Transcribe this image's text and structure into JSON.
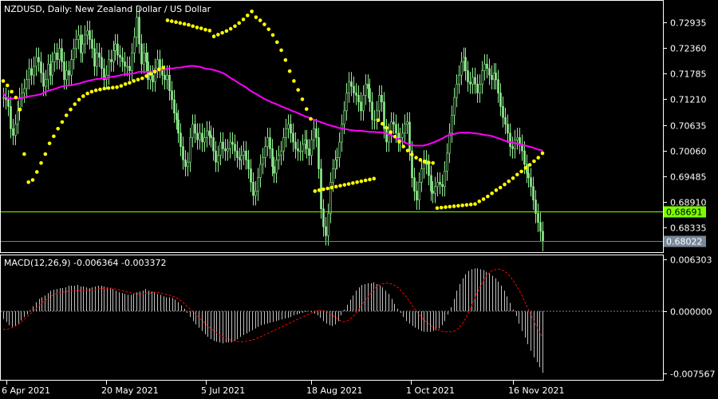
{
  "main_title": "NZDUSD, Daily:  New Zealand Dollar / US Dollar",
  "macd_title": "MACD(12,26,9) -0.006364 -0.003372",
  "colors": {
    "background": "#000000",
    "frame": "#ffffff",
    "candle": "#90ee90",
    "ma_line": "#ff00ff",
    "sar_dots": "#ffff00",
    "level_line": "#7cfc00",
    "level_label_bg": "#7cfc00",
    "bid_line": "#708090",
    "bid_label_bg": "#778899",
    "macd_hist": "#c0c0c0",
    "macd_signal": "#ff0000",
    "zero_line": "#808080"
  },
  "chart_data": [
    {
      "type": "candlestick",
      "title": "NZDUSD, Daily:  New Zealand Dollar / US Dollar",
      "ylim": [
        0.6775,
        0.7335
      ],
      "y_ticks": [
        "0.72935",
        "0.72360",
        "0.71785",
        "0.71210",
        "0.70635",
        "0.70060",
        "0.69485",
        "0.68910",
        "0.68335"
      ],
      "x_ticks": [
        "6 Apr 2021",
        "20 May 2021",
        "5 Jul 2021",
        "18 Aug 2021",
        "1 Oct 2021",
        "16 Nov 2021"
      ],
      "price_labels": {
        "horizontal_level": "0.68691",
        "last_price": "0.68022"
      },
      "close": [
        0.7125,
        0.712,
        0.7105,
        0.7055,
        0.704,
        0.7065,
        0.7095,
        0.7125,
        0.7135,
        0.7145,
        0.7165,
        0.719,
        0.7175,
        0.7195,
        0.7215,
        0.7205,
        0.718,
        0.715,
        0.7165,
        0.72,
        0.7175,
        0.7205,
        0.7225,
        0.721,
        0.7235,
        0.7205,
        0.7165,
        0.7185,
        0.7175,
        0.721,
        0.7235,
        0.7255,
        0.7265,
        0.7225,
        0.7245,
        0.7265,
        0.7275,
        0.7255,
        0.7235,
        0.7195,
        0.7225,
        0.7215,
        0.719,
        0.7165,
        0.7175,
        0.721,
        0.7205,
        0.723,
        0.7245,
        0.722,
        0.7215,
        0.7205,
        0.7195,
        0.7195,
        0.7185,
        0.7225,
        0.726,
        0.7305,
        0.7245,
        0.72,
        0.7225,
        0.7205,
        0.7165,
        0.7175,
        0.716,
        0.719,
        0.721,
        0.719,
        0.7175,
        0.7165,
        0.7175,
        0.714,
        0.712,
        0.709,
        0.7075,
        0.7045,
        0.7015,
        0.6985,
        0.697,
        0.698,
        0.7035,
        0.7065,
        0.7045,
        0.703,
        0.7045,
        0.7025,
        0.7035,
        0.705,
        0.704,
        0.7035,
        0.7005,
        0.698,
        0.6995,
        0.7025,
        0.701,
        0.7005,
        0.701,
        0.7025,
        0.702,
        0.7005,
        0.699,
        0.6985,
        0.6995,
        0.7005,
        0.6985,
        0.6965,
        0.6935,
        0.6905,
        0.6915,
        0.6945,
        0.6975,
        0.699,
        0.7015,
        0.7035,
        0.701,
        0.697,
        0.6955,
        0.6985,
        0.6995,
        0.7005,
        0.7035,
        0.7055,
        0.7065,
        0.7045,
        0.7025,
        0.701,
        0.7005,
        0.7005,
        0.702,
        0.703,
        0.701,
        0.6995,
        0.703,
        0.7055,
        0.7035,
        0.6965,
        0.6875,
        0.6835,
        0.6815,
        0.6865,
        0.6935,
        0.6965,
        0.6985,
        0.699,
        0.7025,
        0.7065,
        0.7095,
        0.7135,
        0.716,
        0.715,
        0.7135,
        0.713,
        0.7115,
        0.7095,
        0.713,
        0.7155,
        0.7145,
        0.7115,
        0.7075,
        0.7075,
        0.7095,
        0.713,
        0.7115,
        0.7055,
        0.7025,
        0.7045,
        0.707,
        0.7065,
        0.7045,
        0.7025,
        0.7035,
        0.7045,
        0.7065,
        0.707,
        0.7005,
        0.6945,
        0.6915,
        0.6895,
        0.6935,
        0.6965,
        0.6985,
        0.6975,
        0.695,
        0.6915,
        0.691,
        0.6925,
        0.6935,
        0.693,
        0.6925,
        0.696,
        0.7,
        0.7045,
        0.7085,
        0.7125,
        0.7155,
        0.7175,
        0.7205,
        0.7215,
        0.7185,
        0.716,
        0.7155,
        0.717,
        0.7155,
        0.7135,
        0.7155,
        0.7185,
        0.72,
        0.719,
        0.7175,
        0.7165,
        0.718,
        0.7165,
        0.7135,
        0.7105,
        0.708,
        0.7065,
        0.7045,
        0.7015,
        0.701,
        0.703,
        0.7035,
        0.702,
        0.7005,
        0.6975,
        0.6955,
        0.6945,
        0.6925,
        0.6895,
        0.6865,
        0.6845,
        0.6825,
        0.6802
      ],
      "ma_line": [
        0.7135,
        0.7124,
        0.7122,
        0.7123,
        0.7123,
        0.7124,
        0.7126,
        0.7128,
        0.7129,
        0.7131,
        0.7133,
        0.7138,
        0.7141,
        0.7143,
        0.7146,
        0.7149,
        0.7151,
        0.7152,
        0.7153,
        0.7155,
        0.7157,
        0.716,
        0.7162,
        0.7164,
        0.7166,
        0.7167,
        0.7168,
        0.7169,
        0.7171,
        0.7172,
        0.7174,
        0.7176,
        0.7177,
        0.7178,
        0.7179,
        0.7182,
        0.7183,
        0.7182,
        0.7183,
        0.7184,
        0.7185,
        0.7187,
        0.7188,
        0.719,
        0.719,
        0.7192,
        0.7192,
        0.7194,
        0.7195,
        0.7196,
        0.7195,
        0.7194,
        0.7191,
        0.7189,
        0.7188,
        0.7186,
        0.7183,
        0.718,
        0.7175,
        0.7169,
        0.7164,
        0.7158,
        0.7153,
        0.7148,
        0.7141,
        0.7136,
        0.7131,
        0.7126,
        0.7121,
        0.7117,
        0.7113,
        0.711,
        0.7106,
        0.7102,
        0.7099,
        0.7095,
        0.7092,
        0.7088,
        0.7084,
        0.7081,
        0.7077,
        0.7074,
        0.7071,
        0.7068,
        0.7065,
        0.7062,
        0.706,
        0.7057,
        0.7055,
        0.7054,
        0.7052,
        0.7051,
        0.705,
        0.705,
        0.7049,
        0.7048,
        0.7048,
        0.7047,
        0.7047,
        0.7045,
        0.7043,
        0.7039,
        0.7034,
        0.703,
        0.7025,
        0.7021,
        0.7018,
        0.7017,
        0.7017,
        0.7017,
        0.7019,
        0.7022,
        0.7025,
        0.7029,
        0.7033,
        0.7038,
        0.7041,
        0.7043,
        0.7045,
        0.7046,
        0.7046,
        0.7046,
        0.7045,
        0.7044,
        0.7043,
        0.7041,
        0.704,
        0.7038,
        0.7035,
        0.7032,
        0.7029,
        0.7026,
        0.7024,
        0.7022,
        0.702,
        0.7018,
        0.7016,
        0.7014,
        0.7011,
        0.7008,
        0.7006
      ],
      "sar": [
        0.7162,
        0.7152,
        0.7138,
        0.7125,
        0.7098,
        0.6998,
        0.6935,
        0.694,
        0.6958,
        0.6978,
        0.6998,
        0.7022,
        0.7038,
        0.7055,
        0.707,
        0.7085,
        0.7098,
        0.711,
        0.712,
        0.7128,
        0.7134,
        0.7138,
        0.7141,
        0.7143,
        0.7145,
        0.7146,
        0.7147,
        0.7148,
        0.7151,
        0.7155,
        0.7158,
        0.7162,
        0.7165,
        0.7168,
        0.7173,
        0.7178,
        0.7183,
        0.7188,
        0.7192,
        0.7298,
        0.7296,
        0.7294,
        0.7292,
        0.729,
        0.7288,
        0.7285,
        0.7282,
        0.728,
        0.7277,
        0.7275,
        0.7262,
        0.7266,
        0.727,
        0.7274,
        0.7279,
        0.7285,
        0.7292,
        0.73,
        0.7309,
        0.7318,
        0.7305,
        0.7298,
        0.7289,
        0.7278,
        0.7265,
        0.7249,
        0.7231,
        0.7209,
        0.7184,
        0.7162,
        0.7142,
        0.7121,
        0.7099,
        0.7077,
        0.6915,
        0.6917,
        0.6919,
        0.6921,
        0.6923,
        0.6925,
        0.6927,
        0.6929,
        0.6931,
        0.6933,
        0.6935,
        0.6937,
        0.6939,
        0.6941,
        0.6943,
        0.7074,
        0.7066,
        0.7057,
        0.7047,
        0.7037,
        0.7026,
        0.7015,
        0.7006,
        0.6997,
        0.699,
        0.6985,
        0.6981,
        0.6979,
        0.6978,
        0.6877,
        0.6878,
        0.6879,
        0.688,
        0.6881,
        0.6882,
        0.6883,
        0.6884,
        0.6885,
        0.6886,
        0.6892,
        0.6897,
        0.6903,
        0.691,
        0.6917,
        0.6923,
        0.693,
        0.6937,
        0.6944,
        0.6952,
        0.6959,
        0.6967,
        0.6974,
        0.6982,
        0.699,
        0.7
      ],
      "horizontal_level": 0.68691,
      "last_price": 0.68022
    },
    {
      "type": "macd",
      "title": "MACD(12,26,9) -0.006364 -0.003372",
      "ylim": [
        -0.0083,
        0.0066
      ],
      "y_ticks": [
        "0.006303",
        "0.000000",
        "-0.007567"
      ],
      "histogram": [
        -0.00095,
        -0.0013,
        -0.0017,
        -0.0019,
        -0.0018,
        -0.0015,
        -0.0011,
        -0.0007,
        -0.0004,
        0.0001,
        0.0006,
        0.0011,
        0.0015,
        0.0017,
        0.0019,
        0.0022,
        0.0025,
        0.0026,
        0.0027,
        0.0028,
        0.0028,
        0.0029,
        0.0031,
        0.0031,
        0.0031,
        0.0032,
        0.003,
        0.003,
        0.0029,
        0.0028,
        0.0029,
        0.003,
        0.0031,
        0.0031,
        0.003,
        0.0029,
        0.0028,
        0.0027,
        0.0025,
        0.0023,
        0.0022,
        0.0021,
        0.002,
        0.002,
        0.0021,
        0.0023,
        0.0024,
        0.0025,
        0.0027,
        0.0025,
        0.0024,
        0.0023,
        0.0021,
        0.002,
        0.0018,
        0.0017,
        0.0017,
        0.0016,
        0.0014,
        0.0011,
        0.0007,
        0.0003,
        -0.0002,
        -0.0007,
        -0.0012,
        -0.0016,
        -0.002,
        -0.0024,
        -0.0028,
        -0.0031,
        -0.0034,
        -0.0036,
        -0.0037,
        -0.0038,
        -0.0039,
        -0.0038,
        -0.0038,
        -0.0038,
        -0.0036,
        -0.0034,
        -0.0031,
        -0.0029,
        -0.0027,
        -0.0025,
        -0.0023,
        -0.0021,
        -0.0019,
        -0.0017,
        -0.0016,
        -0.0015,
        -0.0014,
        -0.0013,
        -0.0012,
        -0.0011,
        -0.001,
        -0.0009,
        -0.0008,
        -0.0007,
        -0.0005,
        -0.0004,
        -0.0003,
        -0.0002,
        -0.0001,
        0.0,
        -0.0001,
        -0.0003,
        -0.0005,
        -0.0008,
        -0.0012,
        -0.0015,
        -0.0017,
        -0.0018,
        -0.0016,
        -0.0012,
        -0.0005,
        0.0002,
        0.0008,
        0.0014,
        0.0019,
        0.0025,
        0.0029,
        0.0032,
        0.0033,
        0.0034,
        0.0034,
        0.0035,
        0.0033,
        0.0031,
        0.0029,
        0.0025,
        0.0021,
        0.0015,
        0.0009,
        0.0003,
        -0.0002,
        -0.0007,
        -0.0012,
        -0.0015,
        -0.0018,
        -0.002,
        -0.0022,
        -0.0024,
        -0.0025,
        -0.0025,
        -0.0025,
        -0.0024,
        -0.0023,
        -0.0021,
        -0.0017,
        -0.0012,
        -0.0004,
        0.0005,
        0.0015,
        0.0025,
        0.0033,
        0.004,
        0.0045,
        0.0049,
        0.0051,
        0.0052,
        0.0052,
        0.0051,
        0.005,
        0.0048,
        0.0046,
        0.0043,
        0.004,
        0.0036,
        0.0031,
        0.0025,
        0.0018,
        0.001,
        0.0002,
        -0.0006,
        -0.0015,
        -0.0024,
        -0.0032,
        -0.004,
        -0.0048,
        -0.0056,
        -0.0062,
        -0.0068,
        -0.0075
      ],
      "signal": [
        -0.0022,
        -0.0022,
        -0.0021,
        -0.0019,
        -0.0017,
        -0.0014,
        -0.001,
        -0.0006,
        -0.0002,
        0.0002,
        0.0006,
        0.001,
        0.0013,
        0.0016,
        0.0019,
        0.0021,
        0.0022,
        0.0023,
        0.0024,
        0.0024,
        0.0025,
        0.0025,
        0.0025,
        0.0025,
        0.0026,
        0.0026,
        0.0026,
        0.0027,
        0.0028,
        0.0028,
        0.0028,
        0.0028,
        0.0027,
        0.0026,
        0.0025,
        0.0024,
        0.0023,
        0.0022,
        0.0021,
        0.0021,
        0.0021,
        0.0022,
        0.0022,
        0.0023,
        0.0023,
        0.0022,
        0.0021,
        0.002,
        0.0019,
        0.0017,
        0.0015,
        0.0012,
        0.0008,
        0.0004,
        0.0,
        -0.0004,
        -0.0008,
        -0.0012,
        -0.0016,
        -0.002,
        -0.0023,
        -0.0026,
        -0.0029,
        -0.0031,
        -0.0033,
        -0.0035,
        -0.0036,
        -0.0037,
        -0.0037,
        -0.0037,
        -0.0036,
        -0.0035,
        -0.0034,
        -0.0032,
        -0.003,
        -0.0028,
        -0.0026,
        -0.0024,
        -0.0022,
        -0.002,
        -0.0018,
        -0.0016,
        -0.0014,
        -0.0012,
        -0.001,
        -0.0008,
        -0.0006,
        -0.0004,
        -0.0002,
        0.0,
        0.0001,
        0.0001,
        -0.0,
        -0.0002,
        -0.0005,
        -0.0008,
        -0.0011,
        -0.0013,
        -0.0012,
        -0.001,
        -0.0006,
        -0.0001,
        0.0005,
        0.0011,
        0.0017,
        0.0022,
        0.0027,
        0.0031,
        0.0033,
        0.0034,
        0.0034,
        0.0033,
        0.0031,
        0.0028,
        0.0023,
        0.0018,
        0.0012,
        0.0006,
        0.0,
        -0.0005,
        -0.001,
        -0.0014,
        -0.0017,
        -0.002,
        -0.0022,
        -0.0024,
        -0.0025,
        -0.0025,
        -0.0025,
        -0.0024,
        -0.0021,
        -0.0016,
        -0.0009,
        -0.0001,
        0.0009,
        0.0019,
        0.0028,
        0.0036,
        0.0043,
        0.0048,
        0.005,
        0.0051,
        0.0051,
        0.0049,
        0.0046,
        0.0041,
        0.0035,
        0.0028,
        0.002,
        0.0011,
        0.0002,
        -0.0007,
        -0.0016,
        -0.0024,
        -0.0031
      ]
    }
  ]
}
